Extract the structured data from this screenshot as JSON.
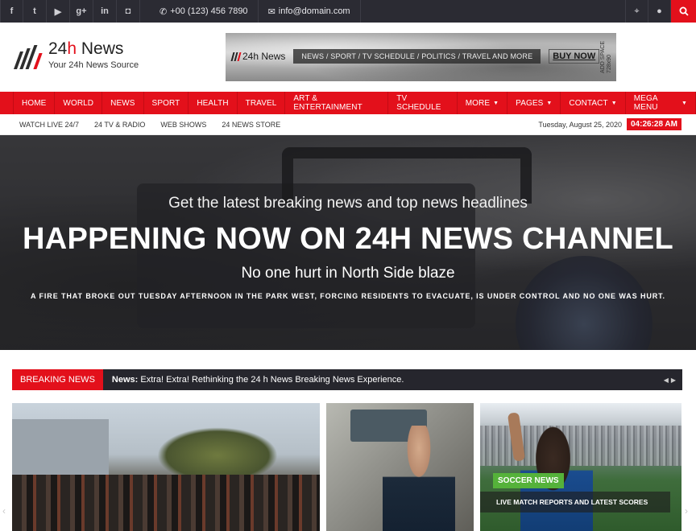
{
  "topbar": {
    "social": [
      {
        "icon": "facebook-icon",
        "glyph": "f"
      },
      {
        "icon": "twitter-icon",
        "glyph": "t"
      },
      {
        "icon": "youtube-icon",
        "glyph": "▶"
      },
      {
        "icon": "google-plus-icon",
        "glyph": "g+"
      },
      {
        "icon": "linkedin-icon",
        "glyph": "in"
      },
      {
        "icon": "instagram-icon",
        "glyph": "◘"
      }
    ],
    "phone": "+00 (123) 456 7890",
    "email": "info@domain.com"
  },
  "header": {
    "logo_num": "24",
    "logo_h": "h",
    "logo_word": " News",
    "tagline": "Your 24h News Source"
  },
  "ad": {
    "brand": "24h News",
    "categories": "NEWS / SPORT / TV SCHEDULE / POLITICS / TRAVEL  AND MORE",
    "cta": "BUY NOW",
    "space_line1": "ADD SPACE",
    "space_line2": "728x90"
  },
  "nav": {
    "items": [
      {
        "label": "HOME"
      },
      {
        "label": "WORLD"
      },
      {
        "label": "NEWS"
      },
      {
        "label": "SPORT"
      },
      {
        "label": "HEALTH"
      },
      {
        "label": "TRAVEL"
      },
      {
        "label": "ART & ENTERTAINMENT"
      },
      {
        "label": "TV SCHEDULE"
      },
      {
        "label": "MORE"
      },
      {
        "label": "PAGES"
      },
      {
        "label": "CONTACT"
      },
      {
        "label": "MEGA MENU"
      }
    ]
  },
  "subnav": {
    "links": [
      "WATCH LIVE 24/7",
      "24 TV & RADIO",
      "WEB SHOWS",
      "24 NEWS STORE"
    ],
    "date": "Tuesday, August 25, 2020",
    "time": "04:26:28 AM"
  },
  "hero": {
    "kicker": "Get the latest breaking news and top news headlines",
    "title": "HAPPENING NOW ON 24H NEWS CHANNEL",
    "subtitle": "No one hurt in North Side blaze",
    "description": "A FIRE THAT BROKE OUT TUESDAY AFTERNOON IN THE PARK WEST, FORCING RESIDENTS TO EVACUATE, IS UNDER CONTROL AND NO ONE WAS HURT."
  },
  "breaking": {
    "label": "BREAKING NEWS",
    "prefix": "News:",
    "text": " Extra! Extra! Rethinking the 24 h News Breaking News Experience."
  },
  "cards": {
    "card3_tag": "SOCCER NEWS",
    "card3_caption": "LIVE MATCH REPORTS AND LATEST SCORES"
  },
  "colors": {
    "accent": "#e3101b",
    "topbar": "#2b2b33",
    "tag_green": "#55b23a"
  }
}
